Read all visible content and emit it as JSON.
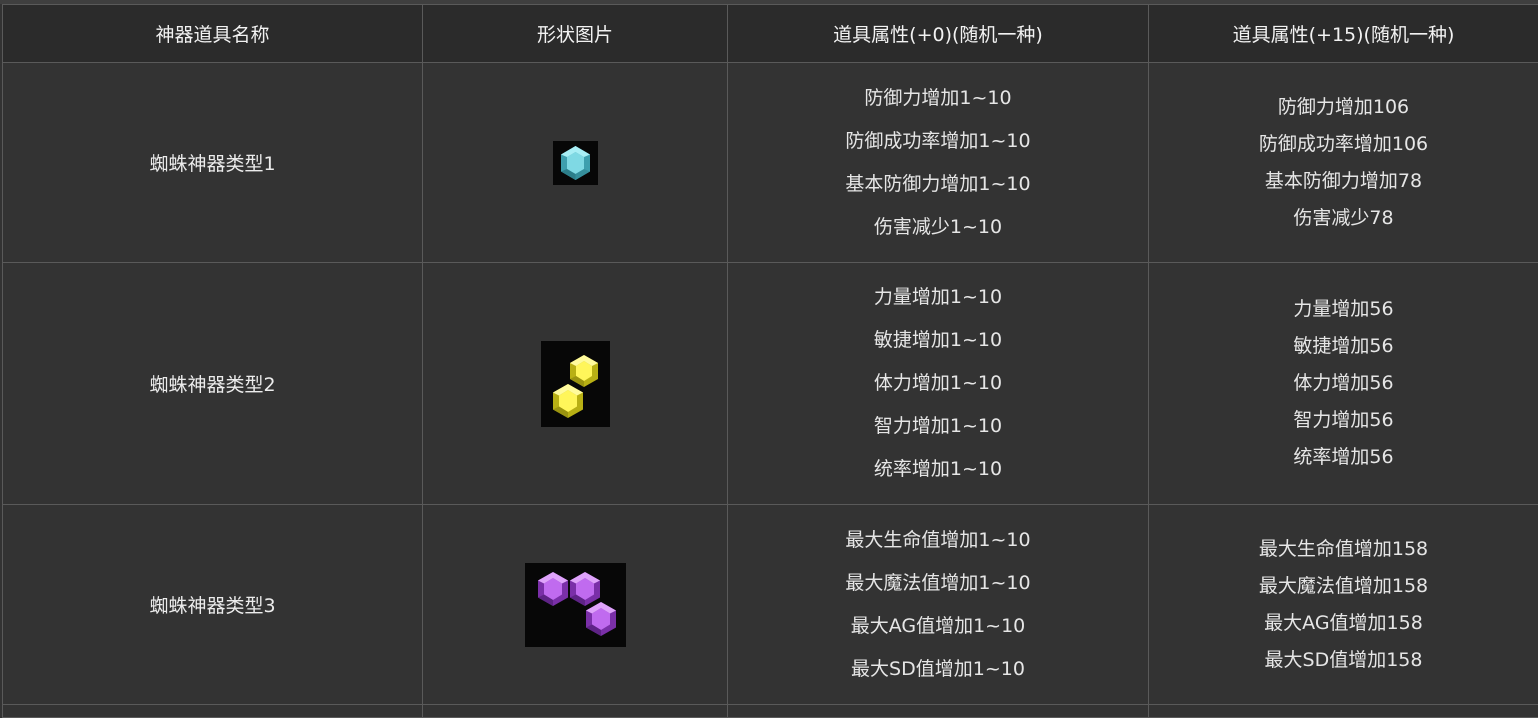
{
  "table": {
    "headers": [
      "神器道具名称",
      "形状图片",
      "道具属性(+0)(随机一种)",
      "道具属性(+15)(随机一种)"
    ],
    "rows": [
      {
        "name": "蜘蛛神器类型1",
        "image": "cyan-gem-icon",
        "attrs_base": [
          "防御力增加1~10",
          "防御成功率增加1~10",
          "基本防御力增加1~10",
          "伤害减少1~10"
        ],
        "attrs_15": [
          "防御力增加106",
          "防御成功率增加106",
          "基本防御力增加78",
          "伤害减少78"
        ]
      },
      {
        "name": "蜘蛛神器类型2",
        "image": "yellow-gems-icon",
        "attrs_base": [
          "力量增加1~10",
          "敏捷增加1~10",
          "体力增加1~10",
          "智力增加1~10",
          "统率增加1~10"
        ],
        "attrs_15": [
          "力量增加56",
          "敏捷增加56",
          "体力增加56",
          "智力增加56",
          "统率增加56"
        ]
      },
      {
        "name": "蜘蛛神器类型3",
        "image": "purple-gems-icon",
        "attrs_base": [
          "最大生命值增加1~10",
          "最大魔法值增加1~10",
          "最大AG值增加1~10",
          "最大SD值增加1~10"
        ],
        "attrs_15": [
          "最大生命值增加158",
          "最大魔法值增加158",
          "最大AG值增加158",
          "最大SD值增加158"
        ]
      }
    ]
  },
  "colors": {
    "background": "#333333",
    "header_bg": "#2b2b2b",
    "border": "#5a5a5a",
    "text": "#e6e6e6",
    "gem_cyan": "#5fc3d0",
    "gem_yellow": "#f3ee2a",
    "gem_purple": "#b04fe0"
  }
}
